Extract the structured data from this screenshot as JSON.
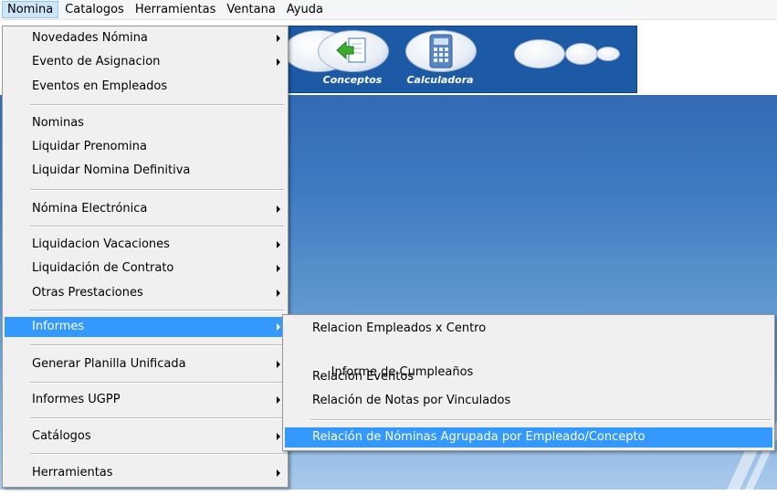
{
  "menubar": {
    "items": [
      "Nomina",
      "Catalogos",
      "Herramientas",
      "Ventana",
      "Ayuda"
    ]
  },
  "toolbar": {
    "conceptos_label": "Conceptos",
    "calculadora_label": "Calculadora"
  },
  "nomina_menu": {
    "items": [
      "Novedades Nómina",
      "Evento de Asignacion",
      "Eventos en Empleados",
      "Nominas",
      "Liquidar Prenomina",
      "Liquidar Nomina Definitiva",
      "Nómina Electrónica",
      "Liquidacion Vacaciones",
      "Liquidación de Contrato",
      "Otras Prestaciones",
      "Informes",
      "Generar Planilla Unificada",
      "Informes UGPP",
      "Catálogos",
      "Herramientas"
    ]
  },
  "informes_menu": {
    "items": [
      "Relacion Empleados x Centro",
      " Informe de Cumpleaños",
      "Relacion Eventos",
      "Relación de Notas por Vinculados",
      "Relación de Nóminas Agrupada por Empleado/Concepto"
    ]
  },
  "colors": {
    "highlight": "#3399ff",
    "toolbar": "#1c5aa6"
  }
}
